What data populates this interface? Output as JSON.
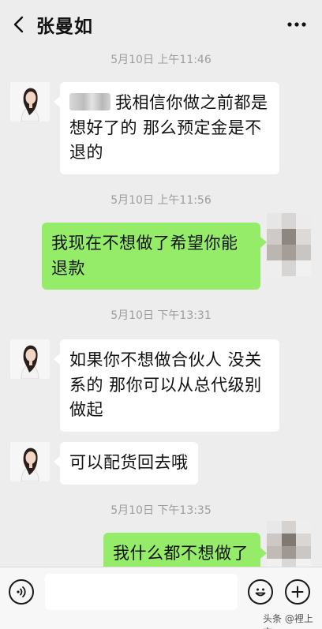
{
  "header": {
    "title": "张曼如"
  },
  "messages": [
    {
      "type": "timestamp",
      "text": "5月10日 上午11:46"
    },
    {
      "type": "incoming",
      "text": "我相信你做之前都是想好了的 那么预定金是不退的"
    },
    {
      "type": "timestamp",
      "text": "5月10日 上午11:56"
    },
    {
      "type": "outgoing",
      "text": "我现在不想做了希望你能退款"
    },
    {
      "type": "timestamp",
      "text": "5月10日 下午13:31"
    },
    {
      "type": "incoming",
      "text": "如果你不想做合伙人 没关系的 那你可以从总代级别做起"
    },
    {
      "type": "incoming",
      "text": "可以配货回去哦"
    },
    {
      "type": "timestamp",
      "text": "5月10日 下午13:35"
    },
    {
      "type": "outgoing",
      "text": "我什么都不想做了"
    }
  ],
  "footer": {
    "watermark": "头条 @裡上言"
  },
  "colors": {
    "background": "#ededed",
    "incoming_bubble": "#ffffff",
    "outgoing_bubble": "#95ec69",
    "timestamp_text": "#9d9d9d"
  },
  "icons": {
    "back": "chevron-left-icon",
    "more": "more-dots-icon",
    "voice": "voice-icon",
    "emoji": "emoji-icon",
    "plus": "plus-icon"
  }
}
